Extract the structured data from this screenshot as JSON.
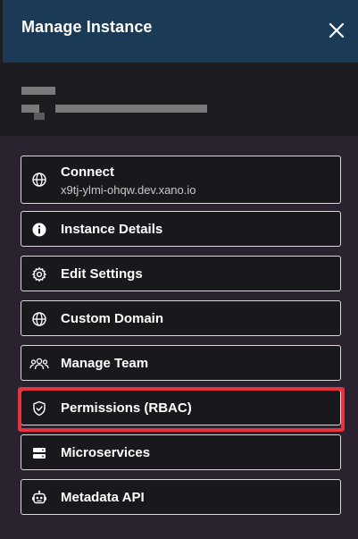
{
  "header": {
    "title": "Manage Instance"
  },
  "menu": {
    "connect": {
      "label": "Connect",
      "host": "x9tj-ylmi-ohqw.dev.xano.io",
      "icon": "globe-icon"
    },
    "items": [
      {
        "label": "Instance Details",
        "icon": "info-icon"
      },
      {
        "label": "Edit Settings",
        "icon": "gear-icon"
      },
      {
        "label": "Custom Domain",
        "icon": "globe-icon"
      },
      {
        "label": "Manage Team",
        "icon": "team-icon"
      },
      {
        "label": "Permissions (RBAC)",
        "icon": "shield-check-icon"
      },
      {
        "label": "Microservices",
        "icon": "server-icon"
      },
      {
        "label": "Metadata API",
        "icon": "robot-icon"
      }
    ]
  },
  "colors": {
    "header_bg": "#1b3a55",
    "list_bg": "#2b2230",
    "item_bg": "#19181d",
    "highlight": "#e5333f"
  }
}
